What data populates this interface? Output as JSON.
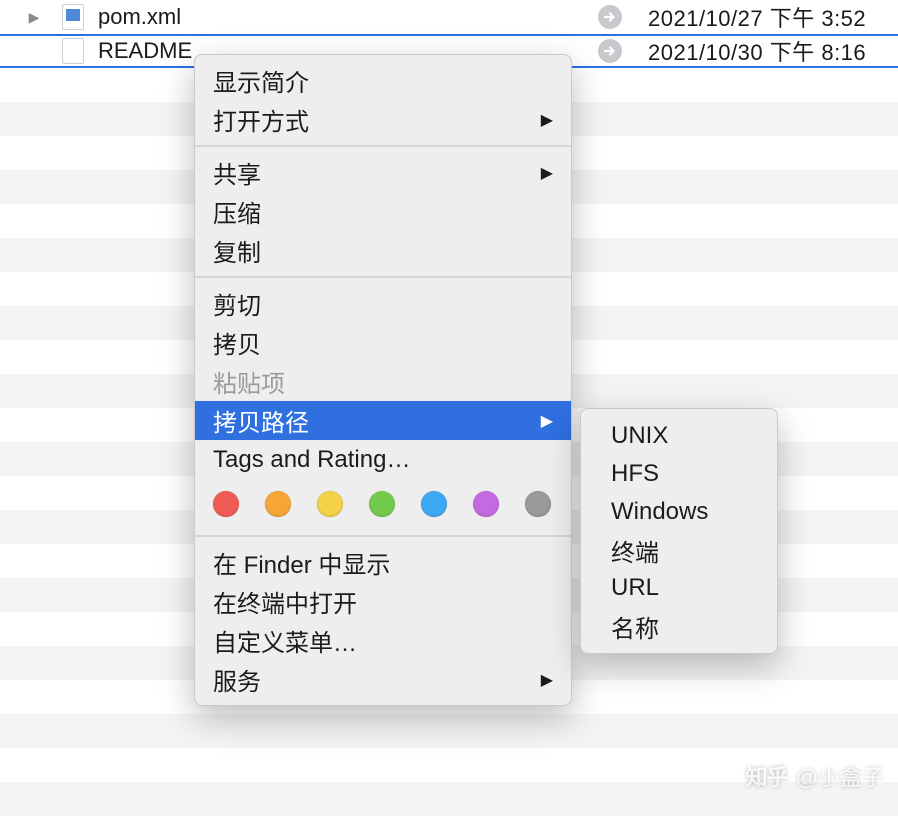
{
  "files": [
    {
      "name": "pom.xml",
      "date": "2021/10/27 下午 3:52",
      "disclosure": true,
      "iconBlue": true
    },
    {
      "name": "README",
      "date": "2021/10/30 下午 8:16",
      "disclosure": false,
      "iconBlue": false,
      "selected": true
    }
  ],
  "menu": {
    "group1": [
      "显示简介"
    ],
    "openWith": "打开方式",
    "share": "共享",
    "group2": [
      "压缩",
      "复制"
    ],
    "group3": [
      "剪切",
      "拷贝"
    ],
    "pasteItem": "粘贴项",
    "copyPath": "拷贝路径",
    "tagsRating": "Tags and Rating…",
    "group4": [
      "在 Finder 中显示",
      "在终端中打开",
      "自定义菜单…"
    ],
    "services": "服务"
  },
  "colors": [
    "#f05b55",
    "#f5a637",
    "#f3d148",
    "#73ca4b",
    "#3fa8f4",
    "#c46ae0",
    "#9a9a9a"
  ],
  "submenu": [
    "UNIX",
    "HFS",
    "Windows",
    "终端",
    "URL",
    "名称"
  ],
  "watermark": {
    "brand": "知乎",
    "author": "@小盒子"
  }
}
